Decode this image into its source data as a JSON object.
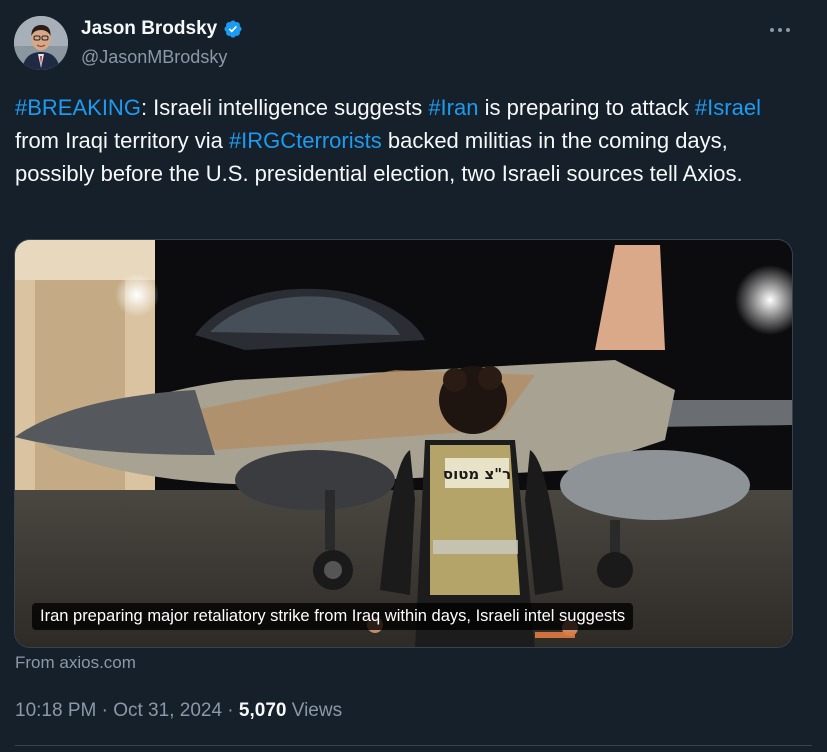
{
  "author": {
    "name": "Jason Brodsky",
    "handle": "@JasonMBrodsky",
    "verified_icon": "verified-badge-icon",
    "badge_color": "#1d9bf0"
  },
  "more_icon": "more-options-icon",
  "tweet": {
    "segments": [
      {
        "text": "#BREAKING",
        "type": "hashtag"
      },
      {
        "text": ": Israeli intelligence suggests ",
        "type": "text"
      },
      {
        "text": "#Iran",
        "type": "hashtag"
      },
      {
        "text": " is preparing to attack ",
        "type": "text"
      },
      {
        "text": "#Israel",
        "type": "hashtag"
      },
      {
        "text": " from Iraqi territory via ",
        "type": "text"
      },
      {
        "text": "#IRGCterrorists",
        "type": "hashtag"
      },
      {
        "text": " backed militias in the coming days, possibly before the U.S. presidential election, two Israeli sources tell Axios.",
        "type": "text"
      }
    ]
  },
  "media": {
    "caption": "Iran preparing major retaliatory strike from Iraq within days, Israeli intel suggests",
    "vest_text": "ר\"צ מטוס"
  },
  "source": "From axios.com",
  "meta": {
    "time": "10:18 PM",
    "separator": "·",
    "date": "Oct 31, 2024",
    "views_count": "5,070",
    "views_label": "Views"
  },
  "colors": {
    "background": "#15202b",
    "text": "#f7f9f9",
    "secondary": "#8b98a5",
    "hashtag": "#1d9bf0",
    "border": "#38444d"
  }
}
